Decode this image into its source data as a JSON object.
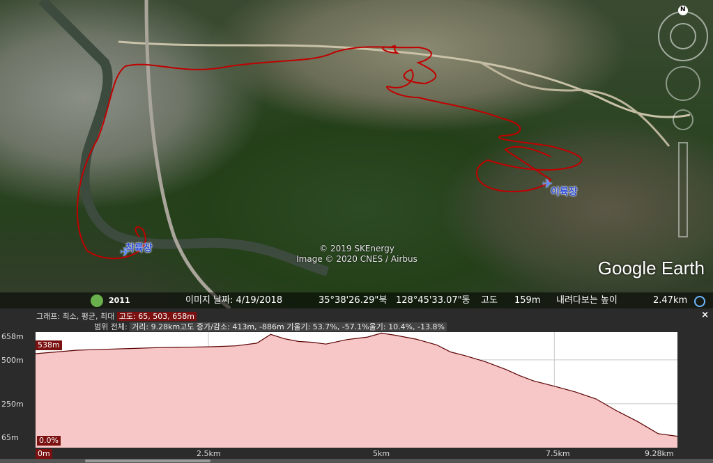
{
  "map": {
    "markers": [
      {
        "label": "착륙장"
      },
      {
        "label": "이륙장"
      }
    ],
    "copyright_lines": [
      "© 2019 SKEnergy",
      "Image © 2020 CNES / Airbus"
    ],
    "logo": "Google Earth",
    "compass_letter": "N"
  },
  "statusbar": {
    "history_year": "2011",
    "image_date": "이미지 날짜: 4/19/2018",
    "lat": "35°38'26.29\"북",
    "lon": "128°45'33.07\"동",
    "altitude_label": "고도",
    "altitude_value": "159m",
    "eye_label": "내려다보는 높이",
    "eye_value": "2.47km"
  },
  "elevation_panel": {
    "graph_label": "그래프: 최소, 평균, 최대",
    "graph_values": "고도: 65, 503, 658m",
    "range_label": "범위 전체:",
    "range_values": "거리: 9.28km고도 증가/감소: 413m, -886m 기울기: 53.7%, -57.1%울기: 10.4%, -13.8%",
    "close": "×",
    "y_ticks": [
      "658m",
      "500m",
      "250m",
      "65m"
    ],
    "x_ticks": [
      "0m",
      "2.5km",
      "5km",
      "7.5km",
      "9.28km"
    ],
    "cursor_elev": "538m",
    "cursor_slope": "0.0%"
  },
  "chart_data": {
    "type": "area",
    "xlabel": "",
    "ylabel": "",
    "xlim": [
      0,
      9.28
    ],
    "ylim": [
      0,
      658
    ],
    "fill_color": "#f7c6c6",
    "line_color": "#5a0000",
    "x": [
      0,
      0.3,
      0.6,
      1.0,
      1.4,
      1.8,
      2.2,
      2.6,
      2.9,
      3.2,
      3.4,
      3.6,
      3.8,
      4.0,
      4.2,
      4.5,
      4.8,
      5.0,
      5.2,
      5.5,
      5.8,
      6.0,
      6.2,
      6.5,
      6.8,
      7.0,
      7.2,
      7.5,
      7.8,
      8.1,
      8.4,
      8.7,
      9.0,
      9.28
    ],
    "values": [
      535,
      545,
      555,
      560,
      565,
      570,
      572,
      575,
      580,
      595,
      645,
      620,
      605,
      600,
      590,
      615,
      630,
      652,
      640,
      618,
      585,
      545,
      525,
      490,
      445,
      410,
      380,
      350,
      318,
      278,
      210,
      150,
      80,
      65
    ]
  }
}
